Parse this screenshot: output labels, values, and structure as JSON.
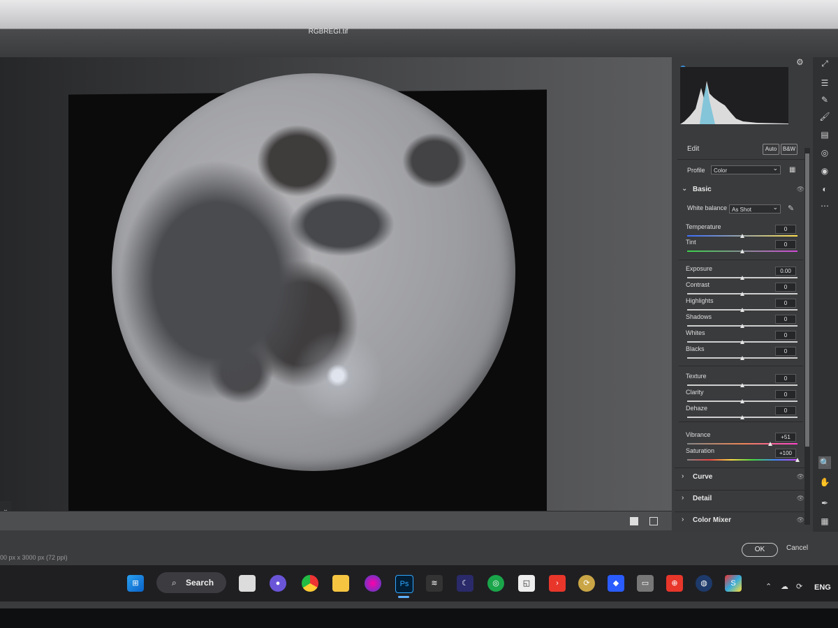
{
  "window": {
    "title": "RGBREGI.tif"
  },
  "footer": {
    "image_info": "00 px x 3000 px (72 ppi)",
    "ok_label": "OK",
    "cancel_label": "Cancel"
  },
  "panel": {
    "edit_label": "Edit",
    "auto_label": "Auto",
    "bw_label": "B&W",
    "profile_label": "Profile",
    "profile_value": "Color",
    "basic_label": "Basic",
    "white_balance_label": "White balance",
    "white_balance_value": "As Shot",
    "sliders": [
      {
        "id": "temperature",
        "label": "Temperature",
        "value": "0",
        "fraction": 0.5
      },
      {
        "id": "tint",
        "label": "Tint",
        "value": "0",
        "fraction": 0.5
      },
      {
        "id": "exposure",
        "label": "Exposure",
        "value": "0.00",
        "fraction": 0.5
      },
      {
        "id": "contrast",
        "label": "Contrast",
        "value": "0",
        "fraction": 0.5
      },
      {
        "id": "highlights",
        "label": "Highlights",
        "value": "0",
        "fraction": 0.5
      },
      {
        "id": "shadows",
        "label": "Shadows",
        "value": "0",
        "fraction": 0.5
      },
      {
        "id": "whites",
        "label": "Whites",
        "value": "0",
        "fraction": 0.5
      },
      {
        "id": "blacks",
        "label": "Blacks",
        "value": "0",
        "fraction": 0.5
      },
      {
        "id": "texture",
        "label": "Texture",
        "value": "0",
        "fraction": 0.5
      },
      {
        "id": "clarity",
        "label": "Clarity",
        "value": "0",
        "fraction": 0.5
      },
      {
        "id": "dehaze",
        "label": "Dehaze",
        "value": "0",
        "fraction": 0.5
      },
      {
        "id": "vibrance",
        "label": "Vibrance",
        "value": "+51",
        "fraction": 0.755
      },
      {
        "id": "saturation",
        "label": "Saturation",
        "value": "+100",
        "fraction": 1.0
      }
    ],
    "collapsed_sections": [
      "Curve",
      "Detail",
      "Color Mixer"
    ]
  },
  "taskbar": {
    "search_label": "Search",
    "language": "ENG",
    "apps": [
      "windows-start",
      "task-view",
      "zoom",
      "chrome",
      "file-explorer",
      "app-orb",
      "photoshop",
      "app-pipp",
      "app-astro",
      "app-green",
      "app-snip",
      "app-red-arrow",
      "app-link",
      "app-blue-gem",
      "app-scope",
      "app-red-square",
      "app-orbit",
      "app-siril"
    ]
  },
  "colors": {
    "accent": "#3b8fd9",
    "panel_bg": "#3a3b3d",
    "taskbar_bg": "#1f1f22"
  }
}
